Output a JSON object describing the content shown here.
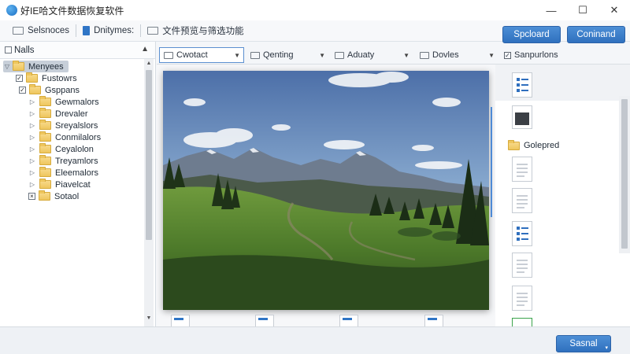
{
  "window": {
    "title": "好IE哈文件数据恢复软件",
    "minimize": "—",
    "maximize": "☐",
    "close": "✕"
  },
  "toolbar": {
    "items": [
      {
        "label": "Selsnoces",
        "icon": "folder-icon"
      },
      {
        "label": "Dnitymes:",
        "icon": "document-icon"
      },
      {
        "label": "文件预览与筛选功能",
        "icon": "folder-icon"
      }
    ],
    "btn_upload": "Spcloard",
    "btn_confirm": "Coninand"
  },
  "left_panel": {
    "header": "Nalls",
    "tree": [
      {
        "label": "Menyees",
        "twisty": "▽",
        "check": "",
        "selected": true
      },
      {
        "label": "Fustowrs",
        "twisty": "",
        "check": "✓",
        "selected": false
      },
      {
        "label": "Gsppans",
        "twisty": "",
        "check": "✓",
        "selected": false
      },
      {
        "label": "Gewmalors",
        "twisty": "▷",
        "check": "",
        "selected": false
      },
      {
        "label": "Drevaler",
        "twisty": "▷",
        "check": "",
        "selected": false
      },
      {
        "label": "Sreyalslors",
        "twisty": "▷",
        "check": "",
        "selected": false
      },
      {
        "label": "Conmilalors",
        "twisty": "▷",
        "check": "",
        "selected": false
      },
      {
        "label": "Ceyalolon",
        "twisty": "▷",
        "check": "",
        "selected": false
      },
      {
        "label": "Treyamlors",
        "twisty": "▷",
        "check": "",
        "selected": false
      },
      {
        "label": "Eleemalors",
        "twisty": "▷",
        "check": "",
        "selected": false
      },
      {
        "label": "Piavelcat",
        "twisty": "▷",
        "check": "",
        "selected": false
      },
      {
        "label": "Sotaol",
        "twisty": "",
        "check": "×",
        "selected": false
      }
    ]
  },
  "columns": [
    {
      "label": "Cwotact",
      "active": true
    },
    {
      "label": "Qenting",
      "active": false
    },
    {
      "label": "Aduaty",
      "active": false
    },
    {
      "label": "Dovles",
      "active": false
    },
    {
      "label": "Sanpurlons",
      "active": false
    }
  ],
  "right_panel": {
    "folder_label": "Golepred"
  },
  "bottom": {
    "btn_label": "Sasnal"
  }
}
